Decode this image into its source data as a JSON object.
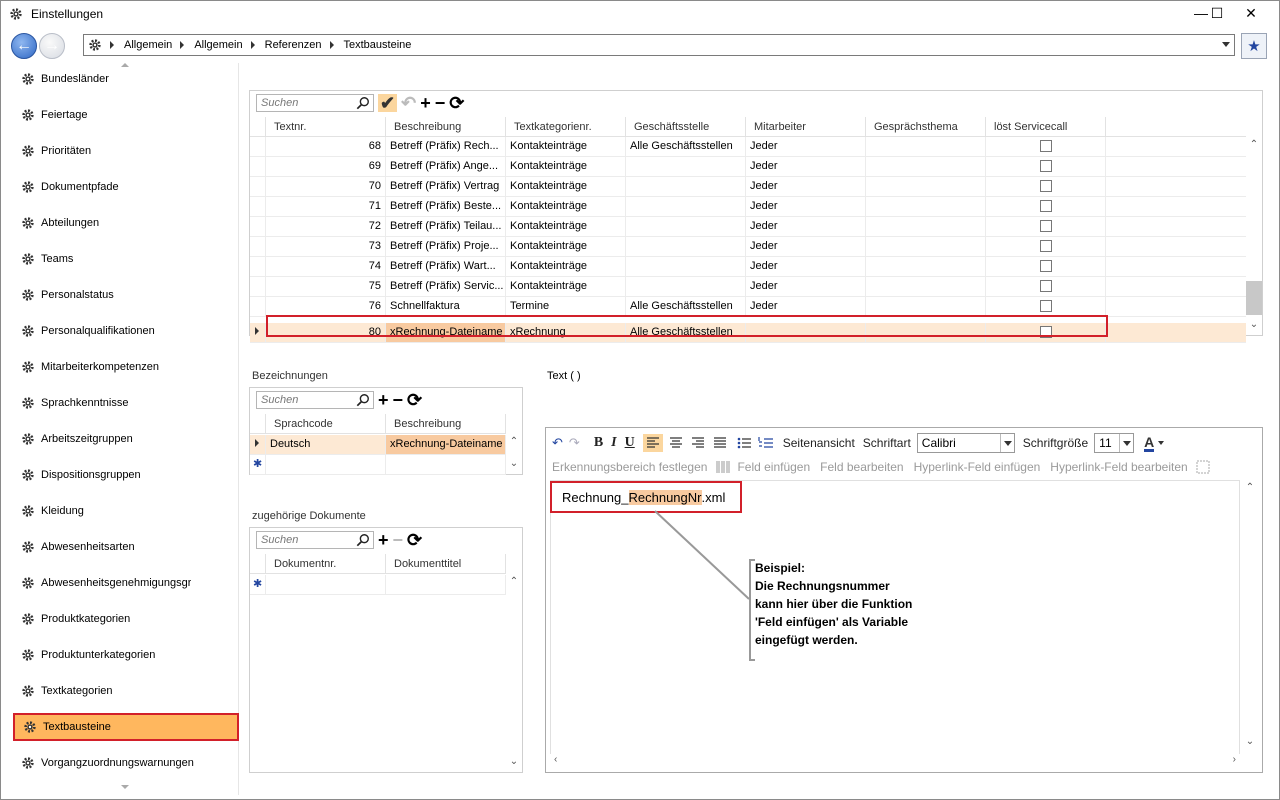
{
  "window": {
    "title": "Einstellungen",
    "min": "—",
    "max": "☐",
    "close": "✕"
  },
  "nav": {
    "back": "←",
    "fwd": "→",
    "crumbs": [
      "Allgemein",
      "Allgemein",
      "Referenzen",
      "Textbausteine"
    ],
    "star": "★"
  },
  "sidebar": {
    "items": [
      "Bundesländer",
      "Feiertage",
      "Prioritäten",
      "Dokumentpfade",
      "Abteilungen",
      "Teams",
      "Personalstatus",
      "Personalqualifikationen",
      "Mitarbeiterkompetenzen",
      "Sprachkenntnisse",
      "Arbeitszeitgruppen",
      "Dispositionsgruppen",
      "Kleidung",
      "Abwesenheitsarten",
      "Abwesenheitsgenehmigungsgr",
      "Produktkategorien",
      "Produktunterkategorien",
      "Textkategorien",
      "Textbausteine",
      "Vorgangzuordnungswarnungen"
    ],
    "active": "Textbausteine"
  },
  "main_grid": {
    "search_placeholder": "Suchen",
    "toolbar": {
      "save": "✔",
      "undo": "↶",
      "add": "+",
      "remove": "−",
      "refresh": "⟳"
    },
    "columns": [
      "Textnr.",
      "Beschreibung",
      "Textkategorienr.",
      "Geschäftsstelle",
      "Mitarbeiter",
      "Gesprächsthema",
      "löst Servicecall"
    ],
    "rows": [
      {
        "nr": "68",
        "beschreibung": "Betreff (Präfix) Rech...",
        "kat": "Kontakteinträge",
        "gs": "Alle Geschäftsstellen",
        "ma": "Jeder",
        "thema": ""
      },
      {
        "nr": "69",
        "beschreibung": "Betreff (Präfix) Ange...",
        "kat": "Kontakteinträge",
        "gs": "",
        "ma": "Jeder",
        "thema": ""
      },
      {
        "nr": "70",
        "beschreibung": "Betreff (Präfix) Vertrag",
        "kat": "Kontakteinträge",
        "gs": "",
        "ma": "Jeder",
        "thema": ""
      },
      {
        "nr": "71",
        "beschreibung": "Betreff (Präfix) Beste...",
        "kat": "Kontakteinträge",
        "gs": "",
        "ma": "Jeder",
        "thema": ""
      },
      {
        "nr": "72",
        "beschreibung": "Betreff (Präfix) Teilau...",
        "kat": "Kontakteinträge",
        "gs": "",
        "ma": "Jeder",
        "thema": ""
      },
      {
        "nr": "73",
        "beschreibung": "Betreff (Präfix) Proje...",
        "kat": "Kontakteinträge",
        "gs": "",
        "ma": "Jeder",
        "thema": ""
      },
      {
        "nr": "74",
        "beschreibung": "Betreff (Präfix) Wart...",
        "kat": "Kontakteinträge",
        "gs": "",
        "ma": "Jeder",
        "thema": ""
      },
      {
        "nr": "75",
        "beschreibung": "Betreff (Präfix) Servic...",
        "kat": "Kontakteinträge",
        "gs": "",
        "ma": "Jeder",
        "thema": ""
      },
      {
        "nr": "76",
        "beschreibung": "Schnellfaktura",
        "kat": "Termine",
        "gs": "Alle Geschäftsstellen",
        "ma": "Jeder",
        "thema": ""
      },
      {
        "nr": "80",
        "beschreibung": "xRechnung-Dateiname",
        "kat": "xRechnung",
        "gs": "Alle Geschäftsstellen",
        "ma": "",
        "thema": ""
      }
    ]
  },
  "bezeichnungen": {
    "label": "Bezeichnungen",
    "search_placeholder": "Suchen",
    "columns": [
      "Sprachcode",
      "Beschreibung"
    ],
    "rows": [
      {
        "code": "Deutsch",
        "beschreibung": "xRechnung-Dateiname"
      }
    ],
    "new_row_marker": "✱"
  },
  "dokumente": {
    "label": "zugehörige Dokumente",
    "search_placeholder": "Suchen",
    "columns": [
      "Dokumentnr.",
      "Dokumenttitel"
    ],
    "new_row_marker": "✱"
  },
  "text_label": "Text  ( )",
  "editor": {
    "toolbar1": {
      "undo": "↶",
      "redo": "↷",
      "bold": "B",
      "italic": "I",
      "underline": "U",
      "seitenansicht": "Seitenansicht",
      "schriftart_label": "Schriftart",
      "schriftart": "Calibri",
      "schriftgroesse_label": "Schriftgröße",
      "schriftgroesse": "11",
      "fontcolor": "A"
    },
    "toolbar2": [
      "Erkennungsbereich festlegen",
      "Feld einfügen",
      "Feld bearbeiten",
      "Hyperlink-Feld einfügen",
      "Hyperlink-Feld bearbeiten"
    ],
    "content_prefix": "Rechnung_",
    "content_var": "RechnungNr",
    "content_suffix": ".xml"
  },
  "annotation": {
    "lines": [
      "Beispiel:",
      "Die Rechnungsnummer",
      "kann hier über die Funktion",
      "'Feld einfügen' als Variable",
      "eingefügt werden."
    ]
  },
  "colors": {
    "accent": "#ffb75e",
    "selected_row": "#fde9d4",
    "highlight": "#f8caa0",
    "red_frame": "#d2202a"
  }
}
